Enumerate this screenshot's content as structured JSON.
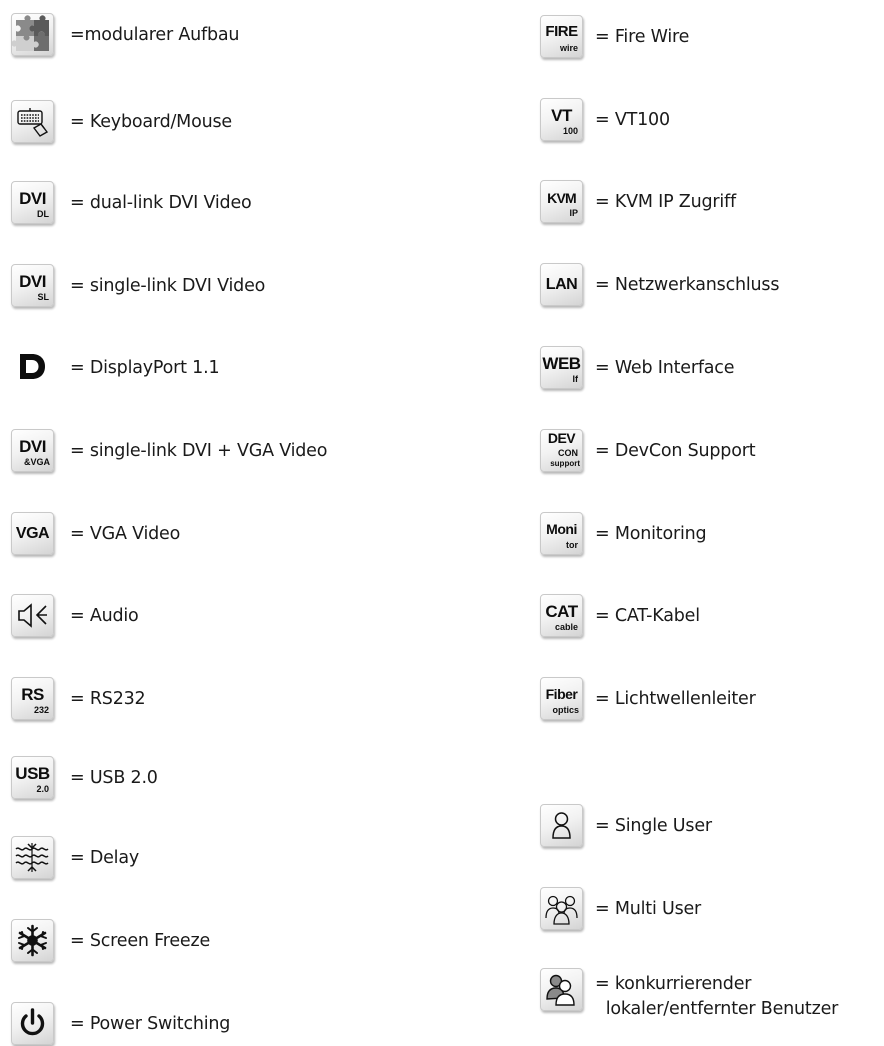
{
  "legend_left": [
    {
      "icon": "puzzle-icon",
      "label": "=modularer Aufbau"
    },
    {
      "icon": "keyboard-mouse-icon",
      "label": "= Keyboard/Mouse"
    },
    {
      "icon": "dvi-dl-icon",
      "main": "DVI",
      "sub": "DL",
      "label": "= dual-link DVI Video"
    },
    {
      "icon": "dvi-sl-icon",
      "main": "DVI",
      "sub": "SL",
      "label": "= single-link DVI Video"
    },
    {
      "icon": "displayport-icon",
      "label": "= DisplayPort 1.1"
    },
    {
      "icon": "dvi-vga-icon",
      "main": "DVI",
      "sub": "&VGA",
      "label": "= single-link DVI + VGA Video"
    },
    {
      "icon": "vga-icon",
      "main": "VGA",
      "label": "= VGA Video"
    },
    {
      "icon": "audio-icon",
      "label": "= Audio"
    },
    {
      "icon": "rs232-icon",
      "main": "RS",
      "sub": "232",
      "label": "= RS232"
    },
    {
      "icon": "usb-icon",
      "main": "USB",
      "sub": "2.0",
      "label": "= USB 2.0"
    },
    {
      "icon": "delay-icon",
      "label": "= Delay"
    },
    {
      "icon": "snowflake-icon",
      "label": "= Screen Freeze"
    },
    {
      "icon": "power-icon",
      "label": "= Power Switching"
    }
  ],
  "legend_right": [
    {
      "icon": "firewire-icon",
      "main": "FIRE",
      "sub": "wire",
      "label": "= Fire Wire"
    },
    {
      "icon": "vt100-icon",
      "main": "VT",
      "sub": "100",
      "label": "= VT100"
    },
    {
      "icon": "kvm-ip-icon",
      "main": "KVM",
      "sub": "IP",
      "label": "= KVM IP Zugriff"
    },
    {
      "icon": "lan-icon",
      "main": "LAN",
      "label": "= Netzwerkanschluss"
    },
    {
      "icon": "web-if-icon",
      "main": "WEB",
      "sub": "If",
      "label": "= Web Interface"
    },
    {
      "icon": "devcon-icon",
      "main": "DEV",
      "sub": "CON",
      "sub2": "support",
      "label": "= DevCon Support"
    },
    {
      "icon": "monitoring-icon",
      "main": "Moni",
      "sub": "tor",
      "label": "= Monitoring"
    },
    {
      "icon": "cat-cable-icon",
      "main": "CAT",
      "sub": "cable",
      "label": "= CAT-Kabel"
    },
    {
      "icon": "fiber-optics-icon",
      "main": "Fiber",
      "sub": "optics",
      "label": "= Lichtwellenleiter"
    },
    {
      "icon": "single-user-icon",
      "label": "= Single User"
    },
    {
      "icon": "multi-user-icon",
      "label": "= Multi User"
    },
    {
      "icon": "concurrent-user-icon",
      "label": "= konkurrierender\n  lokaler/entfernter Benutzer"
    }
  ]
}
